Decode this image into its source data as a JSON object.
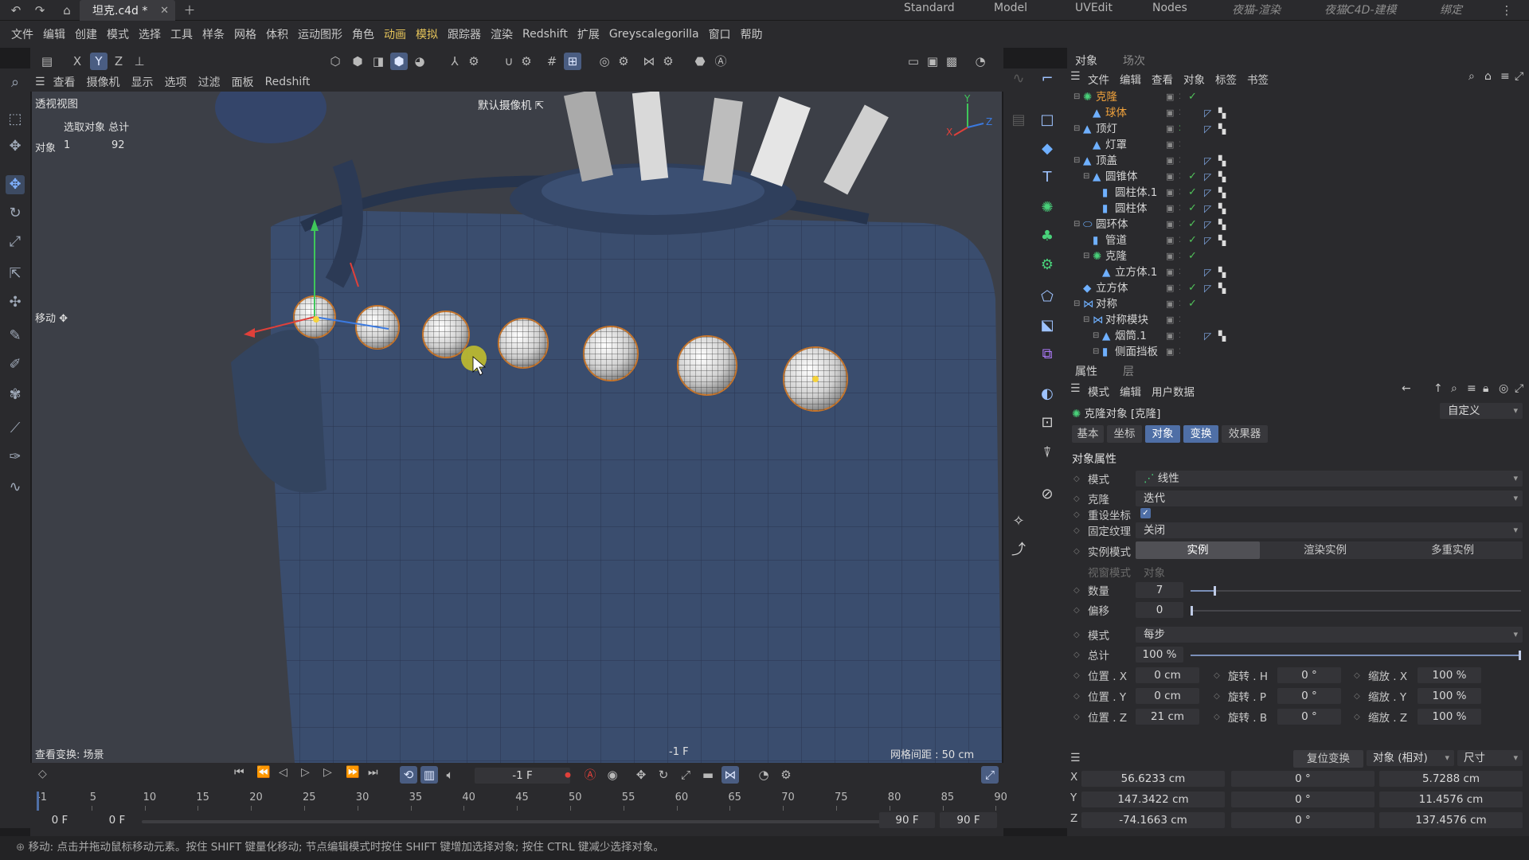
{
  "titlebar": {
    "doc_tab": "坦克.c4d *",
    "workspaces": [
      "Standard",
      "Model",
      "UVEdit",
      "Nodes",
      "夜猫-渲染",
      "夜猫C4D-建模",
      "绑定"
    ]
  },
  "menubar": {
    "items": [
      "文件",
      "编辑",
      "创建",
      "模式",
      "选择",
      "工具",
      "样条",
      "网格",
      "体积",
      "运动图形",
      "角色",
      "动画",
      "模拟",
      "跟踪器",
      "渲染",
      "Redshift",
      "扩展",
      "Greyscalegorilla",
      "窗口",
      "帮助"
    ],
    "highlighted": [
      "动画",
      "模拟"
    ]
  },
  "viewport_menu": [
    "查看",
    "摄像机",
    "显示",
    "选项",
    "过滤",
    "面板",
    "Redshift"
  ],
  "viewport": {
    "name": "透视视图",
    "camera": "默认摄像机",
    "hud_header": "选取对象 总计",
    "hud_row_label": "对象",
    "hud_selected": "1",
    "hud_total": "92",
    "tool_label": "移动",
    "view_transform": "查看变换: 场景",
    "frame": "-1 F",
    "grid": "网格间距 : 50 cm",
    "axis_labels": [
      "Y",
      "X",
      "Z"
    ]
  },
  "objects": {
    "tabs": [
      "对象",
      "场次"
    ],
    "menu": [
      "文件",
      "编辑",
      "查看",
      "对象",
      "标签",
      "书签"
    ],
    "items": [
      {
        "name": "克隆",
        "selected": true
      },
      {
        "name": "球体",
        "selected": true
      },
      {
        "name": "顶灯",
        "selected": false
      },
      {
        "name": "灯罩",
        "selected": false
      },
      {
        "name": "顶盖",
        "selected": false
      },
      {
        "name": "圆锥体",
        "selected": false
      },
      {
        "name": "圆柱体.1",
        "selected": false
      },
      {
        "name": "圆柱体",
        "selected": false
      },
      {
        "name": "圆环体",
        "selected": false
      },
      {
        "name": "管道",
        "selected": false
      },
      {
        "name": "克隆",
        "selected": false
      },
      {
        "name": "立方体.1",
        "selected": false
      },
      {
        "name": "立方体",
        "selected": false
      },
      {
        "name": "对称",
        "selected": false
      },
      {
        "name": "对称模块",
        "selected": false
      },
      {
        "name": "烟筒.1",
        "selected": false
      },
      {
        "name": "侧面挡板",
        "selected": false
      }
    ]
  },
  "attributes": {
    "tabs": [
      "属性",
      "层"
    ],
    "menu": [
      "模式",
      "编辑",
      "用户数据"
    ],
    "object_title": "克隆对象 [克隆]",
    "preset": "自定义",
    "sub_tabs": [
      "基本",
      "坐标",
      "对象",
      "变换",
      "效果器"
    ],
    "active_sub_tabs": [
      "对象",
      "变换"
    ],
    "section": "对象属性",
    "mode_label": "模式",
    "mode_value": "线性",
    "clone_label": "克隆",
    "clone_value": "迭代",
    "reset_label": "重设坐标",
    "fix_tex_label": "固定纹理",
    "fix_tex_value": "关闭",
    "instance_label": "实例模式",
    "instance_options": [
      "实例",
      "渲染实例",
      "多重实例"
    ],
    "viewport_mode_label": "视窗模式",
    "viewport_mode_value": "对象",
    "count_label": "数量",
    "count_value": "7",
    "count_fraction": 0.07,
    "offset_label": "偏移",
    "offset_value": "0",
    "step_label": "模式",
    "step_value": "每步",
    "total_label": "总计",
    "total_value": "100 %",
    "total_fraction": 1.0,
    "pos_labels": [
      "位置 . X",
      "位置 . Y",
      "位置 . Z"
    ],
    "pos_values": [
      "0 cm",
      "0 cm",
      "21 cm"
    ],
    "rot_labels": [
      "旋转 . H",
      "旋转 . P",
      "旋转 . B"
    ],
    "rot_values": [
      "0 °",
      "0 °",
      "0 °"
    ],
    "scale_labels": [
      "缩放 . X",
      "缩放 . Y",
      "缩放 . Z"
    ],
    "scale_values": [
      "100 %",
      "100 %",
      "100 %"
    ]
  },
  "coords": {
    "reset_button": "复位变换",
    "mode_select": "对象 (相对)",
    "size_select": "尺寸",
    "axes": [
      "X",
      "Y",
      "Z"
    ],
    "position": [
      "56.6233 cm",
      "147.3422 cm",
      "-74.1663 cm"
    ],
    "rotation": [
      "0 °",
      "0 °",
      "0 °"
    ],
    "size": [
      "5.7288 cm",
      "11.4576 cm",
      "137.4576 cm"
    ]
  },
  "timeline": {
    "current_frame": "-1 F",
    "ticks": [
      "-1",
      "5",
      "10",
      "15",
      "20",
      "25",
      "30",
      "35",
      "40",
      "45",
      "50",
      "55",
      "60",
      "65",
      "70",
      "75",
      "80",
      "85",
      "90"
    ],
    "start_a": "0 F",
    "start_b": "0 F",
    "end_a": "90 F",
    "end_b": "90 F"
  },
  "status": {
    "text": "移动: 点击并拖动鼠标移动元素。按住 SHIFT 键量化移动; 节点编辑模式时按住 SHIFT 键增加选择对象; 按住 CTRL 键减少选择对象。"
  },
  "colors": {
    "accent": "#4f6fa6",
    "selected_text": "#f0a23c",
    "check": "#51c35a",
    "highlight_menu": "#e6c45a"
  }
}
